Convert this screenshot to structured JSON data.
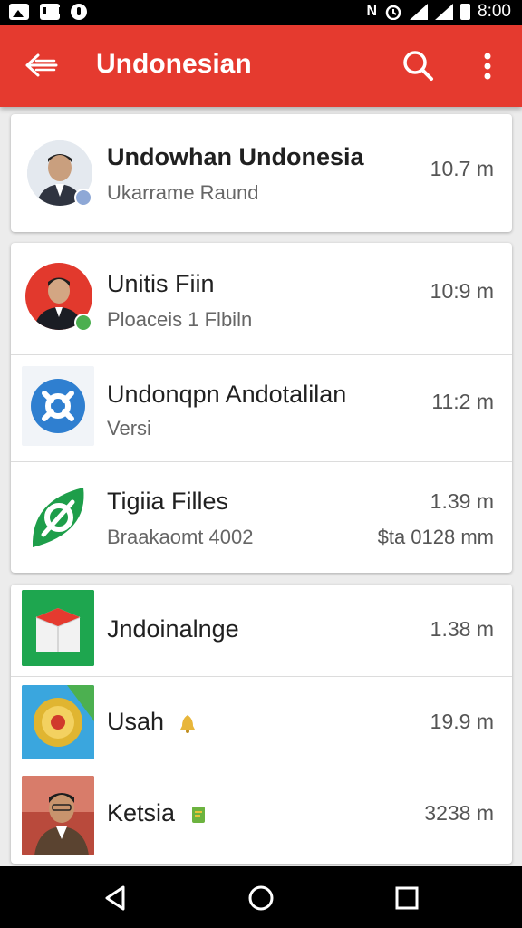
{
  "status_bar": {
    "time": "8:00",
    "network_label": "N"
  },
  "app_bar": {
    "title": "Undonesian"
  },
  "items": [
    {
      "title": "Undowhan Undonesia",
      "subtitle": "Ukarrame Raund",
      "time": "10.7 m"
    },
    {
      "title": "Unitis Fiin",
      "subtitle": "Ploaceis 1 Flbiln",
      "time": "10:9 m"
    },
    {
      "title": "Undonqpn Andotalilan",
      "subtitle": "Versi",
      "time": "11:2 m"
    },
    {
      "title": "Tigiia Filles",
      "subtitle": "Braakaomt 4002",
      "time": "1.39 m",
      "time_secondary": "$ta 0128 mm"
    },
    {
      "title": "Jndoinalnge",
      "time": "1.38 m"
    },
    {
      "title": "Usah",
      "time": "19.9 m"
    },
    {
      "title": "Ketsia",
      "time": "3238 m"
    }
  ],
  "colors": {
    "app_bar": "#e53a2f",
    "status_bar": "#000000",
    "background": "#ececec"
  }
}
